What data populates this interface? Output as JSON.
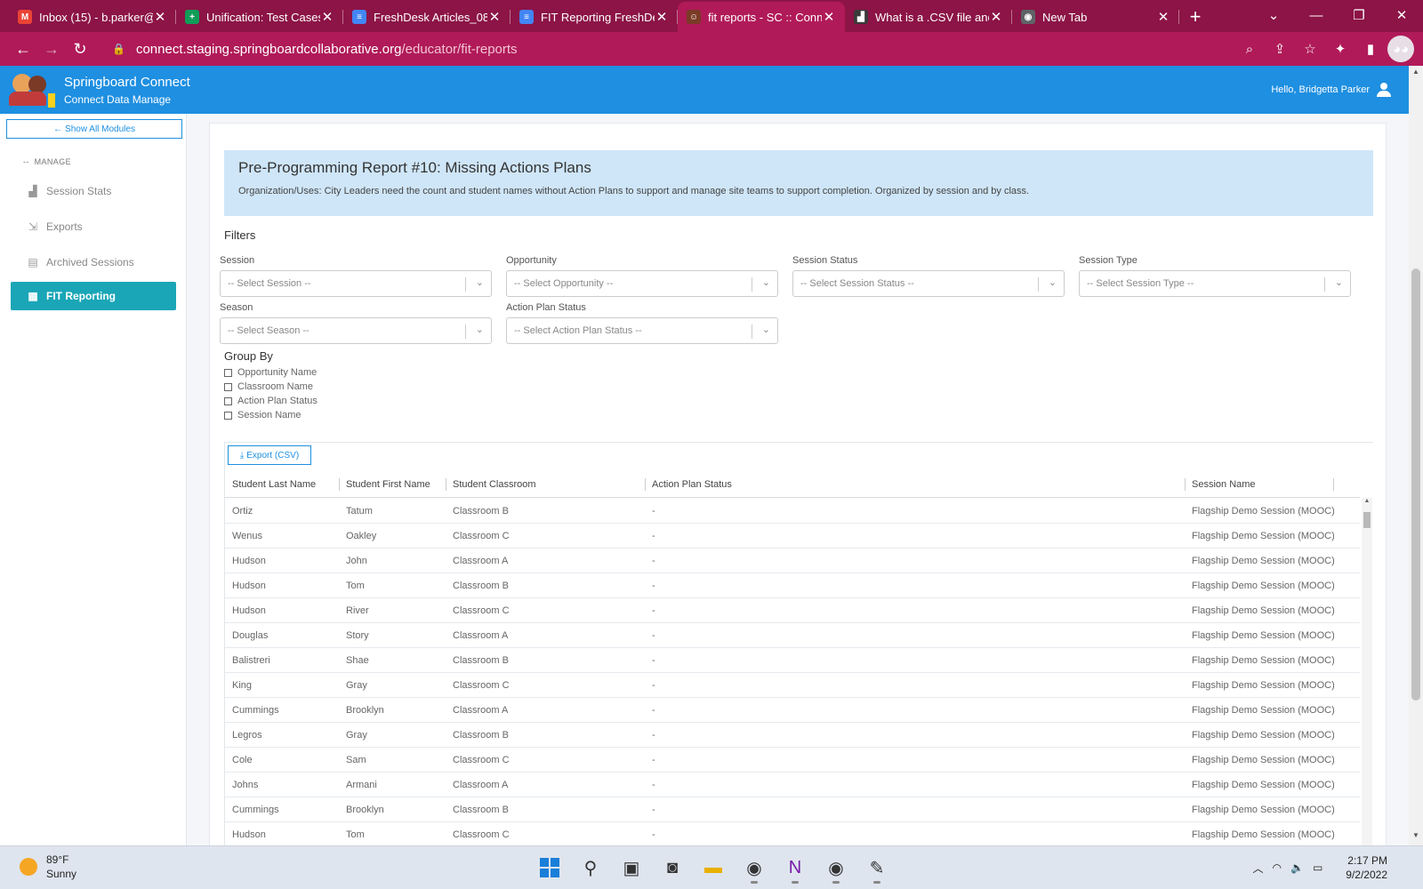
{
  "browser": {
    "tabs": [
      {
        "title": "Inbox (15) - b.parker@",
        "icon_text": "M",
        "icon_color": "#ea4335",
        "active": false
      },
      {
        "title": "Unification: Test Cases",
        "icon_text": "+",
        "icon_color": "#0f9d58",
        "active": false
      },
      {
        "title": "FreshDesk Articles_08",
        "icon_text": "≡",
        "icon_color": "#4285f4",
        "active": false
      },
      {
        "title": "FIT Reporting FreshDe",
        "icon_text": "≡",
        "icon_color": "#4285f4",
        "active": false
      },
      {
        "title": "fit reports - SC :: Conn",
        "icon_text": "☺",
        "icon_color": "#7a3a26",
        "active": true
      },
      {
        "title": "What is a .CSV file and",
        "icon_text": "▟",
        "icon_color": "#3a3a3a",
        "active": false
      },
      {
        "title": "New Tab",
        "icon_text": "◉",
        "icon_color": "#5f6368",
        "active": false
      }
    ],
    "url_host": "connect.staging.springboardcollaborative.org",
    "url_path": "/educator/fit-reports",
    "icons": {
      "back": "←",
      "forward": "→",
      "reload": "↻",
      "lock": "🔒",
      "zoom": "⌕",
      "share": "⇪",
      "star": "☆",
      "extensions": "✦",
      "sidepanel": "▮",
      "profile": "◕◕",
      "close": "✕",
      "newtab": "+",
      "chevron": "⌄",
      "minimize": "—",
      "restore": "❐",
      "win_close": "✕"
    }
  },
  "header": {
    "brand_title": "Springboard Connect",
    "brand_subtitle": "Connect Data Manage",
    "greeting": "Hello, Bridgetta Parker"
  },
  "sidebar": {
    "show_all": "Show All Modules",
    "show_all_icon": "←",
    "section_label": "MANAGE",
    "section_prefix": "--",
    "items": [
      {
        "label": "Session Stats",
        "icon": "▟",
        "active": false
      },
      {
        "label": "Exports",
        "icon": "⇲",
        "active": false
      },
      {
        "label": "Archived Sessions",
        "icon": "▤",
        "active": false
      },
      {
        "label": "FIT Reporting",
        "icon": "▦",
        "active": true
      }
    ]
  },
  "report": {
    "title": "Pre-Programming Report #10: Missing Actions Plans",
    "description": "Organization/Uses: City Leaders need the count and student names without Action Plans to support and manage site teams to support completion. Organized by session and by class."
  },
  "filters": {
    "heading": "Filters",
    "chevron": "⌄",
    "fields": [
      {
        "label": "Session",
        "placeholder": "-- Select Session --"
      },
      {
        "label": "Opportunity",
        "placeholder": "-- Select Opportunity --"
      },
      {
        "label": "Session Status",
        "placeholder": "-- Select Session Status --"
      },
      {
        "label": "Session Type",
        "placeholder": "-- Select Session Type --"
      },
      {
        "label": "Season",
        "placeholder": "-- Select Season --"
      },
      {
        "label": "Action Plan Status",
        "placeholder": "-- Select Action Plan Status --"
      }
    ]
  },
  "group_by": {
    "heading": "Group By",
    "options": [
      "Opportunity Name",
      "Classroom Name",
      "Action Plan Status",
      "Session Name"
    ]
  },
  "table": {
    "export_label": "Export (CSV)",
    "export_icon": "⤓",
    "columns": [
      "Student Last Name",
      "Student First Name",
      "Student Classroom",
      "Action Plan Status",
      "Session Name"
    ],
    "scroll_up": "▲",
    "rows": [
      [
        "Ortiz",
        "Tatum",
        "Classroom B",
        "-",
        "Flagship Demo Session (MOOC)"
      ],
      [
        "Wenus",
        "Oakley",
        "Classroom C",
        "-",
        "Flagship Demo Session (MOOC)"
      ],
      [
        "Hudson",
        "John",
        "Classroom A",
        "-",
        "Flagship Demo Session (MOOC)"
      ],
      [
        "Hudson",
        "Tom",
        "Classroom B",
        "-",
        "Flagship Demo Session (MOOC)"
      ],
      [
        "Hudson",
        "River",
        "Classroom C",
        "-",
        "Flagship Demo Session (MOOC)"
      ],
      [
        "Douglas",
        "Story",
        "Classroom A",
        "-",
        "Flagship Demo Session (MOOC)"
      ],
      [
        "Balistreri",
        "Shae",
        "Classroom B",
        "-",
        "Flagship Demo Session (MOOC)"
      ],
      [
        "King",
        "Gray",
        "Classroom C",
        "-",
        "Flagship Demo Session (MOOC)"
      ],
      [
        "Cummings",
        "Brooklyn",
        "Classroom A",
        "-",
        "Flagship Demo Session (MOOC)"
      ],
      [
        "Legros",
        "Gray",
        "Classroom B",
        "-",
        "Flagship Demo Session (MOOC)"
      ],
      [
        "Cole",
        "Sam",
        "Classroom C",
        "-",
        "Flagship Demo Session (MOOC)"
      ],
      [
        "Johns",
        "Armani",
        "Classroom A",
        "-",
        "Flagship Demo Session (MOOC)"
      ],
      [
        "Cummings",
        "Brooklyn",
        "Classroom B",
        "-",
        "Flagship Demo Session (MOOC)"
      ],
      [
        "Hudson",
        "Tom",
        "Classroom C",
        "-",
        "Flagship Demo Session (MOOC)"
      ]
    ]
  },
  "taskbar": {
    "temperature": "89°F",
    "condition": "Sunny",
    "time": "2:17 PM",
    "date": "9/2/2022",
    "apps": [
      {
        "name": "start",
        "glyph": ""
      },
      {
        "name": "search",
        "glyph": "⚲"
      },
      {
        "name": "task-view",
        "glyph": "▣"
      },
      {
        "name": "teams-chat",
        "glyph": "◙"
      },
      {
        "name": "file-explorer",
        "glyph": "▬"
      },
      {
        "name": "chrome",
        "glyph": "◉"
      },
      {
        "name": "onenote",
        "glyph": "N"
      },
      {
        "name": "chrome-profile",
        "glyph": "◉"
      },
      {
        "name": "paint",
        "glyph": "✎"
      }
    ],
    "tray_icons": {
      "chevron": "︿",
      "wifi": "◠",
      "volume": "🔈",
      "battery": "▭"
    }
  },
  "colors": {
    "browser_frame": "#8c1446",
    "active_tab": "#b01a58",
    "app_header": "#1e8fe1",
    "sidebar_active": "#1aa6b7",
    "banner": "#cfe6f8"
  }
}
